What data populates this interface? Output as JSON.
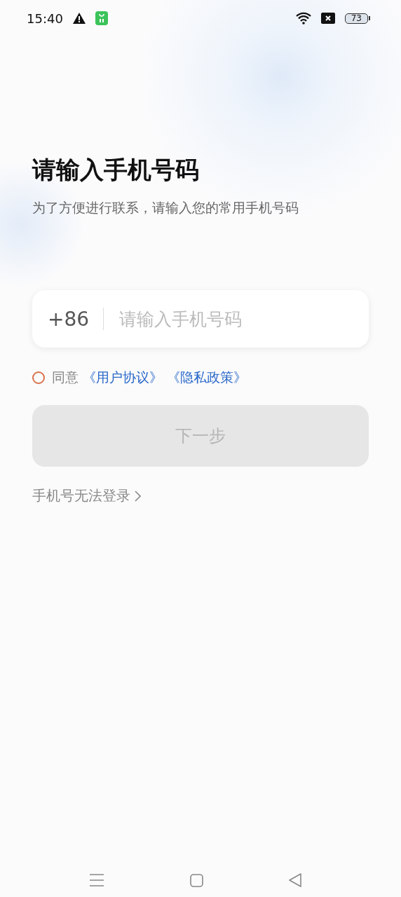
{
  "status_bar": {
    "time": "15:40",
    "battery": "73"
  },
  "title": "请输入手机号码",
  "subtitle": "为了方便进行联系，请输入您的常用手机号码",
  "phone_field": {
    "country_code": "+86",
    "placeholder": "请输入手机号码"
  },
  "agreement": {
    "checked": false,
    "label": "同意",
    "links": [
      "《用户协议》",
      "《隐私政策》"
    ]
  },
  "next_button": {
    "label": "下一步",
    "disabled": true
  },
  "help_link": "手机号无法登录"
}
